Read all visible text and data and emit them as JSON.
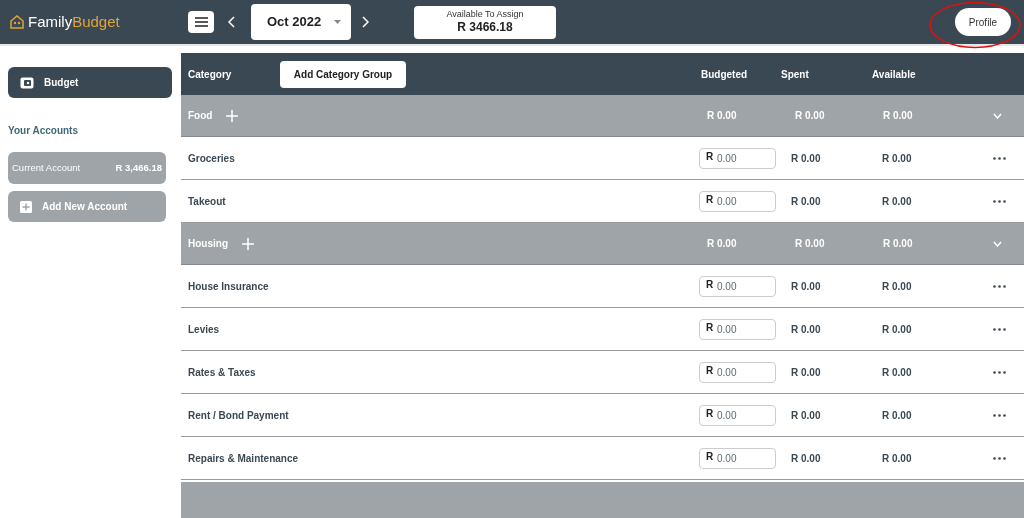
{
  "header": {
    "logo": {
      "part_1": "Family",
      "part_2": "Budget"
    },
    "month": "Oct 2022",
    "available": {
      "label": "Available To Assign",
      "value": "R 3466.18"
    },
    "profile": "Profile"
  },
  "sidebar": {
    "nav": [
      {
        "label": "Budget",
        "selected": true
      }
    ],
    "accounts_title": "Your Accounts",
    "accounts": [
      {
        "name": "Current Account",
        "balance": "R 3,466.18"
      }
    ],
    "add_account": "Add New Account"
  },
  "table": {
    "columns": [
      "Category",
      "Budgeted",
      "Spent",
      "Available"
    ],
    "add_group": "Add Category Group",
    "groups": [
      {
        "name": "Food",
        "budgeted": "R 0.00",
        "spent": "R 0.00",
        "available": "R 0.00",
        "expanded": true,
        "items": [
          {
            "name": "Groceries",
            "currency": "R",
            "placeholder": "0.00",
            "spent": "R 0.00",
            "available": "R 0.00"
          },
          {
            "name": "Takeout",
            "currency": "R",
            "placeholder": "0.00",
            "spent": "R 0.00",
            "available": "R 0.00"
          }
        ]
      },
      {
        "name": "Housing",
        "budgeted": "R 0.00",
        "spent": "R 0.00",
        "available": "R 0.00",
        "expanded": true,
        "items": [
          {
            "name": "House Insurance",
            "currency": "R",
            "placeholder": "0.00",
            "spent": "R 0.00",
            "available": "R 0.00"
          },
          {
            "name": "Levies",
            "currency": "R",
            "placeholder": "0.00",
            "spent": "R 0.00",
            "available": "R 0.00"
          },
          {
            "name": "Rates & Taxes",
            "currency": "R",
            "placeholder": "0.00",
            "spent": "R 0.00",
            "available": "R 0.00"
          },
          {
            "name": "Rent / Bond Payment",
            "currency": "R",
            "placeholder": "0.00",
            "spent": "R 0.00",
            "available": "R 0.00"
          },
          {
            "name": "Repairs & Maintenance",
            "currency": "R",
            "placeholder": "0.00",
            "spent": "R 0.00",
            "available": "R 0.00"
          }
        ]
      }
    ]
  }
}
